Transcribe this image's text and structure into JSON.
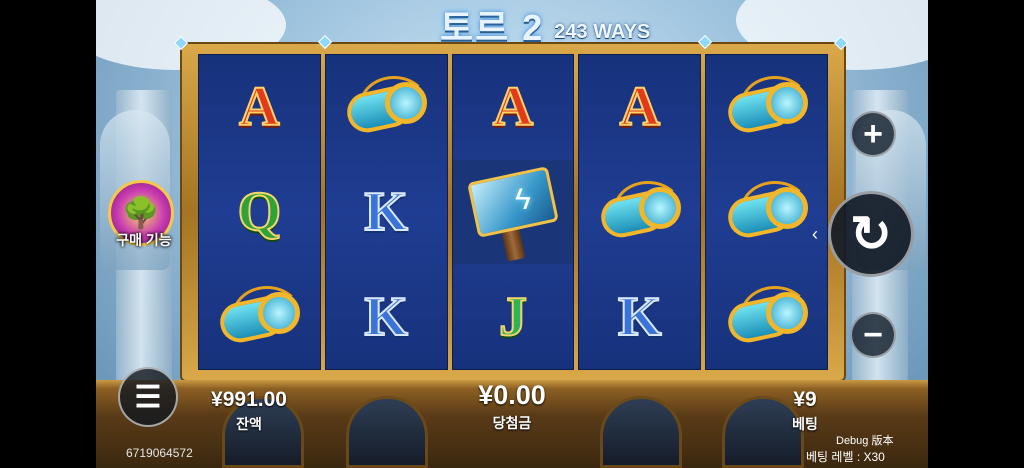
{
  "game": {
    "title": "토르 2",
    "ways": "243 WAYS"
  },
  "reels": [
    [
      "A",
      "Q",
      "cup"
    ],
    [
      "cup",
      "K",
      "K"
    ],
    [
      "A",
      "hammer-wild",
      "J"
    ],
    [
      "A",
      "cup",
      "K"
    ],
    [
      "cup",
      "cup",
      "cup"
    ]
  ],
  "symbols": {
    "A": "A",
    "Q": "Q",
    "K": "K",
    "J": "J"
  },
  "balance": {
    "value": "¥991.00",
    "label": "잔액"
  },
  "win": {
    "value": "¥0.00",
    "label": "당첨금"
  },
  "bet": {
    "value": "¥9",
    "label": "베팅"
  },
  "buy_feature": {
    "label": "구매 기능",
    "icon": "tree-icon"
  },
  "controls": {
    "plus": "+",
    "minus": "−",
    "spin": "↻",
    "menu": "☰"
  },
  "footer": {
    "session_id": "6719064572",
    "debug": "Debug 版本",
    "bet_level": "베팅 레벨 : X30"
  },
  "colors": {
    "reel_bg": "#1f3d92",
    "frame_gold": "#d9a94a",
    "sky": "#9ec3de"
  }
}
